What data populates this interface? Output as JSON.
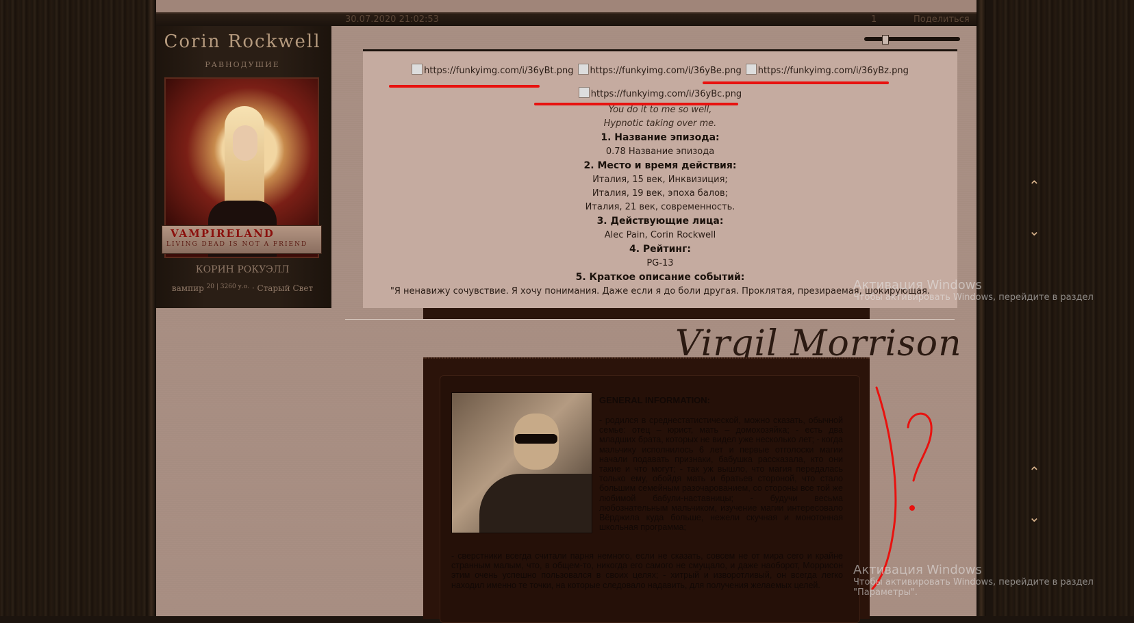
{
  "post": {
    "date": "30.07.2020 21:02:53",
    "number": "1",
    "share": "Поделиться"
  },
  "profile": {
    "name": "Corin Rockwell",
    "status": "РАВНОДУШИЕ",
    "banner_title": "VAMPIRELAND",
    "banner_sub": "LIVING DEAD IS NOT A FRIEND",
    "rus_name": "КОРИН РОКУЭЛЛ",
    "info_race": "вампир",
    "info_age": "20 | 3260 у.о.",
    "info_loc": "· Старый Свет"
  },
  "content": {
    "images": [
      "https://funkyimg.com/i/36yBt.png",
      "https://funkyimg.com/i/36yBe.png",
      "https://funkyimg.com/i/36yBz.png",
      "https://funkyimg.com/i/36yBc.png"
    ],
    "lyric1": "You do it to me so well,",
    "lyric2": "Hypnotic taking over me.",
    "h1": "1. Название эпизода:",
    "v1": "0.78 Название эпизода",
    "h2": "2. Место и время действия:",
    "v2a": "Италия, 15 век, Инквизиция;",
    "v2b": "Италия, 19 век, эпоха балов;",
    "v2c": "Италия, 21 век, современность.",
    "h3": "3. Действующие лица:",
    "v3": "Alec Pain, Corin Rockwell",
    "h4": "4. Рейтинг:",
    "v4": "PG-13",
    "h5": "5. Краткое описание событий:",
    "v5": "\"Я ненавижу сочувствие. Я хочу понимания. Даже если я до боли другая. Проклятая, презираемая, шокирующая."
  },
  "second": {
    "signature": "Virgil Morrison",
    "gen_title": "GENERAL INFORMATION:",
    "gen_text": "- родился в среднестатистической, можно сказать, обычной семье: отец – юрист, мать – домохозяйка; - есть два младших брата, которых не видел уже несколько лет; - когда мальчику исполнилось 6 лет и первые отголоски магии начали подавать признаки, бабушка рассказала, кто они такие и что могут; - так уж вышло, что магия передалась только ему, обойдя мать и братьев стороной, что стало большим семейным разочарованием, со стороны все той же любимой бабули-наставницы; - будучи весьма любознательным мальчиком, изучение магии интересовало Вёрджила куда больше, нежели скучная и монотонная школьная программа;",
    "gen_text2": "- сверстники всегда считали парня немного, если не сказать, совсем не от мира сего и крайне странным малым, что, в общем-то, никогда его самого не смущало, и даже наоборот, Моррисон этим очень успешно пользовался в своих целях; - хитрый и изворотливый, он всегда легко находил именно те точки, на которые следовало надавить, для получения желаемых целей."
  },
  "watermark": {
    "title": "Активация Windows",
    "sub1": "Чтобы активировать Windows, перейдите в раздел",
    "sub2": "\"Параметры\"."
  },
  "annotation": {
    "mark": "?"
  },
  "colors": {
    "accent_red": "#e8120f",
    "wood": "#22180f",
    "paper": "#c5aba0"
  }
}
